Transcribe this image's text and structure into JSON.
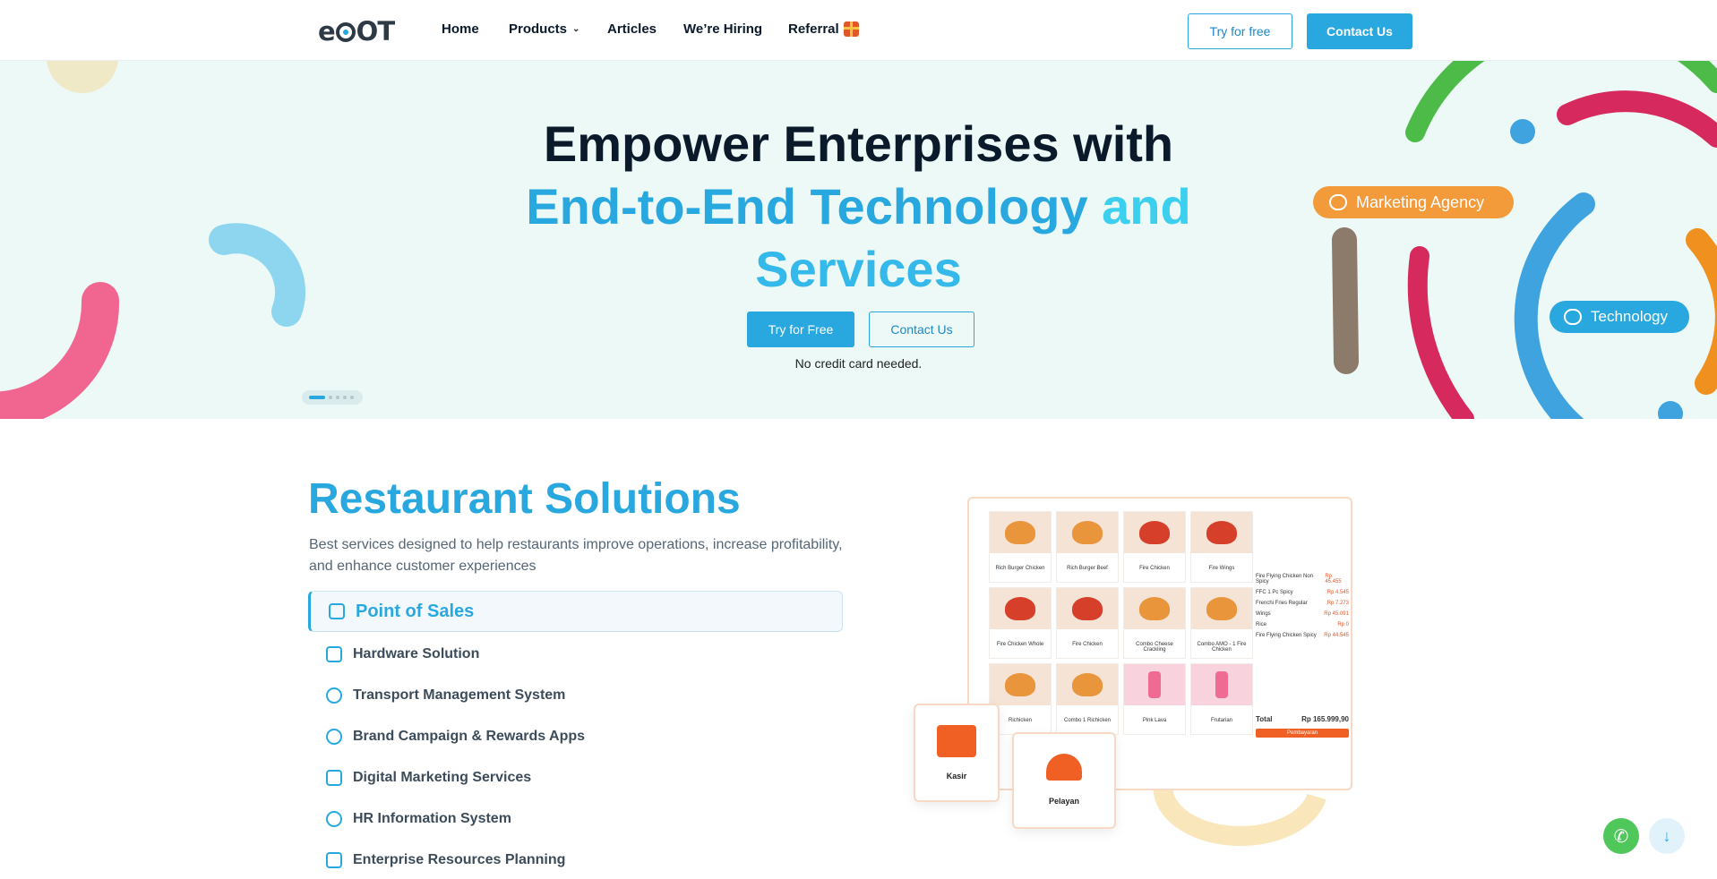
{
  "nav": {
    "logo": "eDOT",
    "links": [
      "Home",
      "Products",
      "Articles",
      "We’re Hiring",
      "Referral"
    ],
    "try_label": "Try for free",
    "contact_label": "Contact Us"
  },
  "hero": {
    "title_line1": "Empower Enterprises with",
    "title_line2a": "End-to-End Technology",
    "title_line2b": " and",
    "title_line3": "Services",
    "try_label": "Try for Free",
    "contact_label": "Contact Us",
    "note": "No credit card needed.",
    "pill_marketing": "Marketing Agency",
    "pill_technology": "Technology",
    "carousel_active_index": 0,
    "carousel_count": 5
  },
  "restaurant": {
    "title": "Restaurant Solutions",
    "description": "Best services designed to help restaurants improve operations, increase profitability, and enhance customer experiences",
    "menu": [
      "Point of Sales",
      "Hardware Solution",
      "Transport Management System",
      "Brand Campaign & Rewards Apps",
      "Digital Marketing Services",
      "HR Information System",
      "Enterprise Resources Planning"
    ],
    "active_index": 0
  },
  "pos_mock": {
    "items": [
      "Rich Burger Chicken",
      "Rich Burger Beef",
      "Fire Chicken",
      "Fire Wings",
      "Fire Chicken Whole",
      "Fire Chicken",
      "Combo Cheese Crackling",
      "Combo AMO - 1 Fire Chicken",
      "Richicken",
      "Combo 1 Richicken",
      "Pink Lava",
      "Frutarian"
    ],
    "order": [
      {
        "name": "Fire Flying Chicken Non Spicy",
        "price": "Rp 45.455"
      },
      {
        "name": "FFC 1 Pc Spicy",
        "price": "Rp 4.545"
      },
      {
        "name": "Frenchi Fries Regular",
        "price": "Rp 7.273"
      },
      {
        "name": "Wings",
        "price": "Rp 45.091"
      },
      {
        "name": "Rice",
        "price": "Rp 0"
      },
      {
        "name": "Fire Flying Chicken Spicy",
        "price": "Rp 44.545"
      }
    ],
    "total_label": "Total",
    "total_value": "Rp 165.999,90",
    "pay_label": "Pembayaran",
    "cashier_label": "Kasir",
    "waiter_label": "Pelayan"
  },
  "colors": {
    "brand": "#29a8e0",
    "hero_bg": "#ecf9f6",
    "accent_orange": "#f39a3a",
    "accent_pink": "#e0326a",
    "accent_green": "#4cbb47"
  },
  "icons": {
    "whatsapp": "whatsapp-icon",
    "scroll_down": "arrow-down-icon"
  }
}
